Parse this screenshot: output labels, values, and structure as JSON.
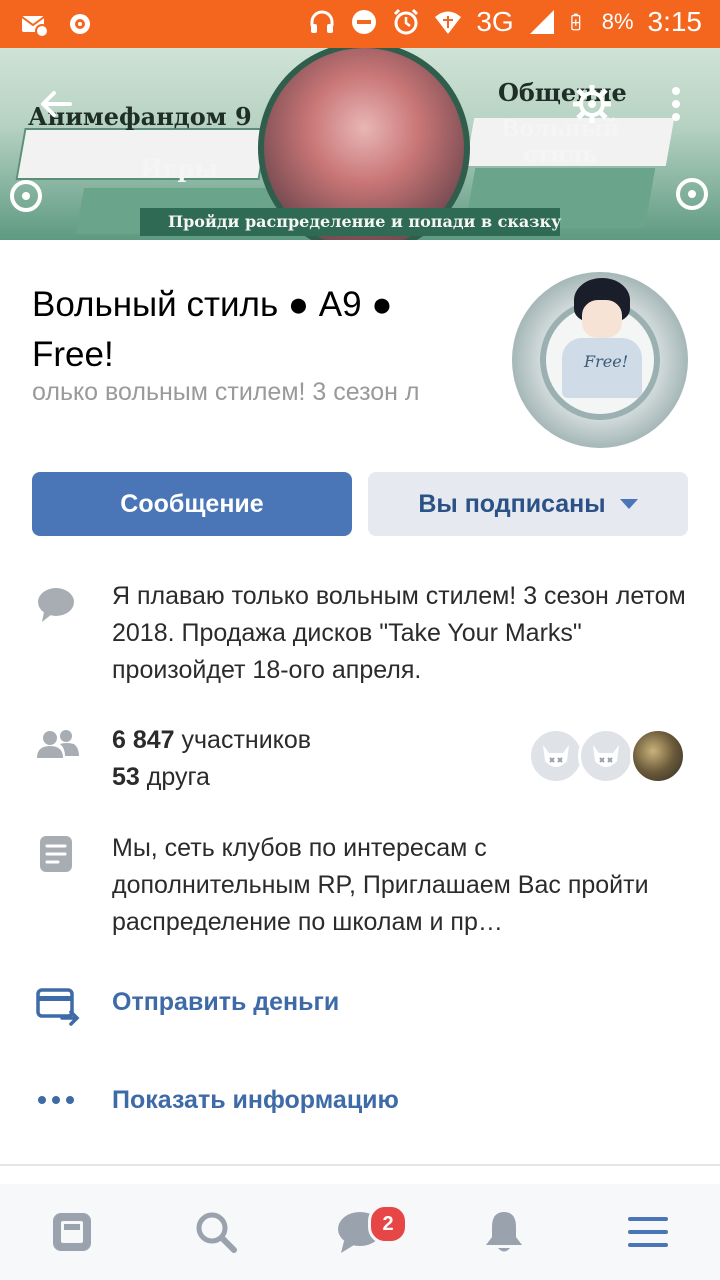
{
  "status_bar": {
    "network": "3G",
    "battery": "8%",
    "time": "3:15"
  },
  "cover": {
    "text_left_top": "Анимефандом 9",
    "text_left_bottom": "Игры",
    "text_right_top": "Общение",
    "text_right_mid": "Вольный стиль",
    "text_strip": "Пройди распределение и попади в сказку"
  },
  "header": {
    "title": "Вольный стиль ● А9 ● Free!",
    "status": "олько вольным стилем! 3 сезон л"
  },
  "avatar": {
    "shirt_text": "Free!"
  },
  "actions": {
    "message": "Сообщение",
    "subscribed": "Вы подписаны"
  },
  "info": {
    "description": "Я плаваю только вольным стилем! 3 сезон летом 2018. Продажа дисков \"Take Your Marks\" произойдет 18-ого апреля.",
    "members_count": "6 847",
    "members_label": "участников",
    "friends_count": "53",
    "friends_label": "друга",
    "about": "Мы, сеть клубов по интересам с дополнительным RP, Приглашаем Вас пройти распределение по школам и пр…",
    "send_money": "Отправить деньги",
    "show_info": "Показать информацию"
  },
  "tabbar": {
    "messages_badge": "2"
  },
  "colors": {
    "status_bar": "#f4651d",
    "primary": "#4a76b8",
    "link": "#3f6aa8",
    "secondary_bg": "#e6e9ef",
    "badge": "#e64646"
  }
}
